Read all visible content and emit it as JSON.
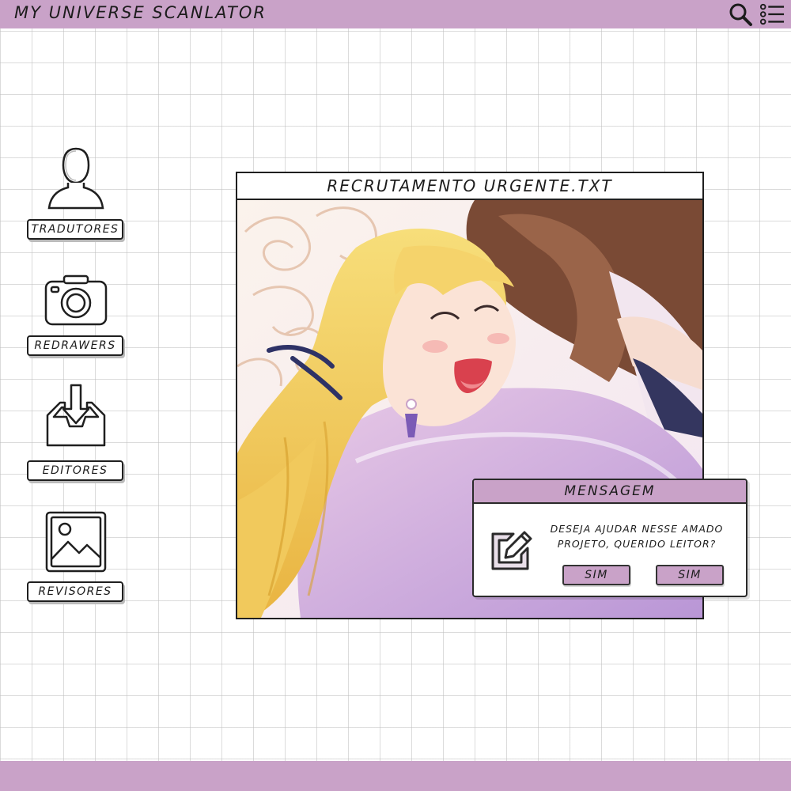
{
  "header": {
    "title": "MY UNIVERSE SCANLATOR",
    "search_icon": "search-icon",
    "menu_icon": "list-menu-icon"
  },
  "sidebar": {
    "items": [
      {
        "label": "TRADUTORES",
        "icon": "user-icon"
      },
      {
        "label": "REDRAWERS",
        "icon": "camera-icon"
      },
      {
        "label": "EDITORES",
        "icon": "download-tray-icon"
      },
      {
        "label": "REVISORES",
        "icon": "image-icon"
      }
    ]
  },
  "window": {
    "title": "RECRUTAMENTO URGENTE.TXT"
  },
  "dialog": {
    "title": "MENSAGEM",
    "icon": "edit-icon",
    "message": "DESEJA AJUDAR NESSE AMADO PROJETO, QUERIDO LEITOR?",
    "buttons": [
      "SIM",
      "SIM"
    ]
  },
  "colors": {
    "accent": "#c9a2c8",
    "outline": "#1f1f1f"
  }
}
